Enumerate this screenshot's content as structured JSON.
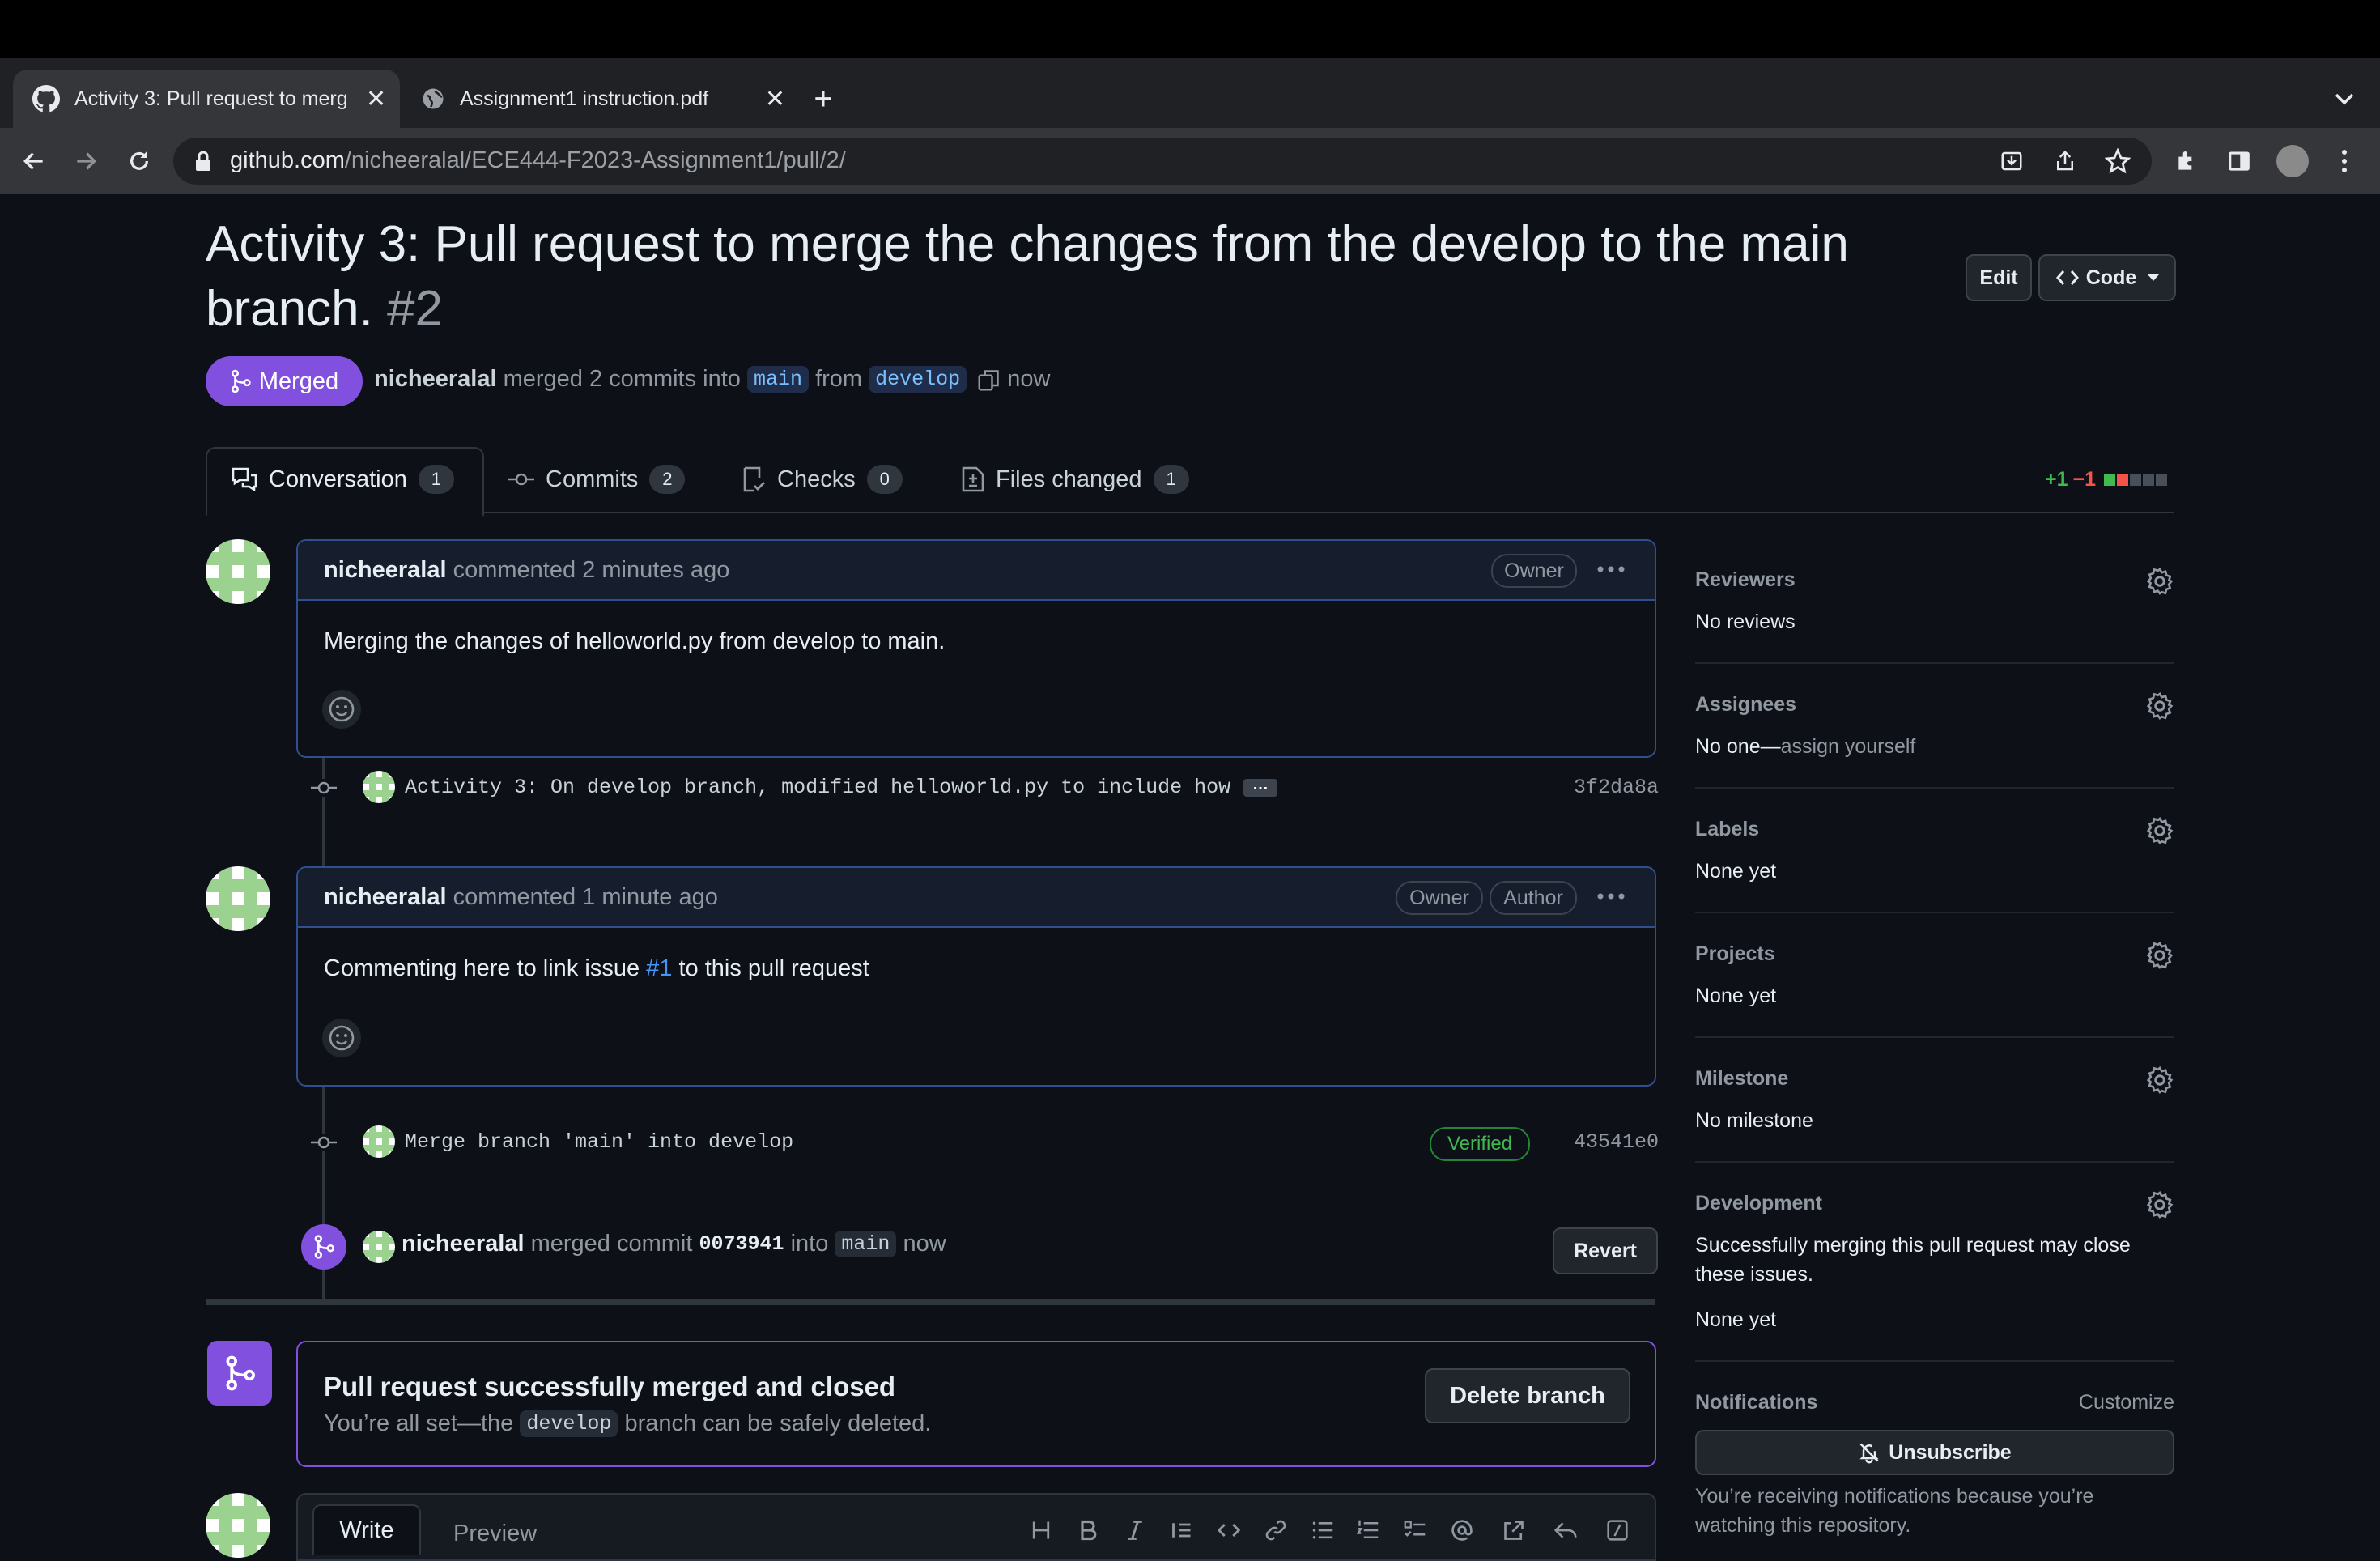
{
  "browser": {
    "tabs": [
      {
        "title": "Activity 3: Pull request to merg",
        "icon": "github-icon",
        "active": true
      },
      {
        "title": "Assignment1 instruction.pdf",
        "icon": "globe-icon",
        "active": false
      }
    ],
    "url_domain": "github.com",
    "url_path": "/nicheeralal/ECE444-F2023-Assignment1/pull/2/"
  },
  "pr": {
    "title": "Activity 3: Pull request to merge the changes from the develop to the main",
    "title_line2": "branch.",
    "number": "#2",
    "state": "Merged",
    "author": "nicheeralal",
    "summary_text": "merged 2 commits into",
    "base_branch": "main",
    "from_text": "from",
    "head_branch": "develop",
    "time": "now",
    "edit_label": "Edit",
    "code_label": "Code"
  },
  "tabs": [
    {
      "label": "Conversation",
      "count": "1",
      "icon": "comment-discussion-icon"
    },
    {
      "label": "Commits",
      "count": "2",
      "icon": "git-commit-icon"
    },
    {
      "label": "Checks",
      "count": "0",
      "icon": "checklist-icon"
    },
    {
      "label": "Files changed",
      "count": "1",
      "icon": "file-diff-icon"
    }
  ],
  "diffstat": {
    "additions": "+1",
    "deletions": "−1"
  },
  "comments": [
    {
      "author": "nicheeralal",
      "action": "commented",
      "time": "2 minutes ago",
      "badges": [
        "Owner"
      ],
      "body": "Merging the changes of helloworld.py from develop to main."
    },
    {
      "author": "nicheeralal",
      "action": "commented",
      "time": "1 minute ago",
      "badges": [
        "Owner",
        "Author"
      ],
      "body_before": "Commenting here to link issue",
      "body_link": "#1",
      "body_after": "to this pull request"
    }
  ],
  "commits": [
    {
      "message": "Activity 3: On develop branch, modified helloworld.py to include how …",
      "sha": "3f2da8a",
      "ellipsis": "…"
    },
    {
      "message": "Merge branch 'main' into develop",
      "sha": "43541e0",
      "verified": "Verified"
    }
  ],
  "merge_event": {
    "author": "nicheeralal",
    "text": "merged commit",
    "commit": "0073941",
    "into": "into",
    "branch": "main",
    "time": "now",
    "revert_label": "Revert"
  },
  "merged_box": {
    "title": "Pull request successfully merged and closed",
    "sub_before": "You’re all set—the",
    "branch": "develop",
    "sub_after": "branch can be safely deleted.",
    "delete_label": "Delete branch"
  },
  "editor": {
    "write_tab": "Write",
    "preview_tab": "Preview"
  },
  "sidebar": {
    "reviewers": {
      "title": "Reviewers",
      "value": "No reviews"
    },
    "assignees": {
      "title": "Assignees",
      "value": "No one—",
      "link": "assign yourself"
    },
    "labels": {
      "title": "Labels",
      "value": "None yet"
    },
    "projects": {
      "title": "Projects",
      "value": "None yet"
    },
    "milestone": {
      "title": "Milestone",
      "value": "No milestone"
    },
    "development": {
      "title": "Development",
      "desc": "Successfully merging this pull request may close these issues.",
      "value": "None yet"
    },
    "notifications": {
      "title": "Notifications",
      "customize": "Customize",
      "button": "Unsubscribe",
      "desc": "You’re receiving notifications because you’re watching this repository."
    }
  },
  "colors": {
    "merged_purple": "#8250df",
    "link_blue": "#4493f8",
    "green": "#3fb950",
    "red": "#f85149"
  }
}
